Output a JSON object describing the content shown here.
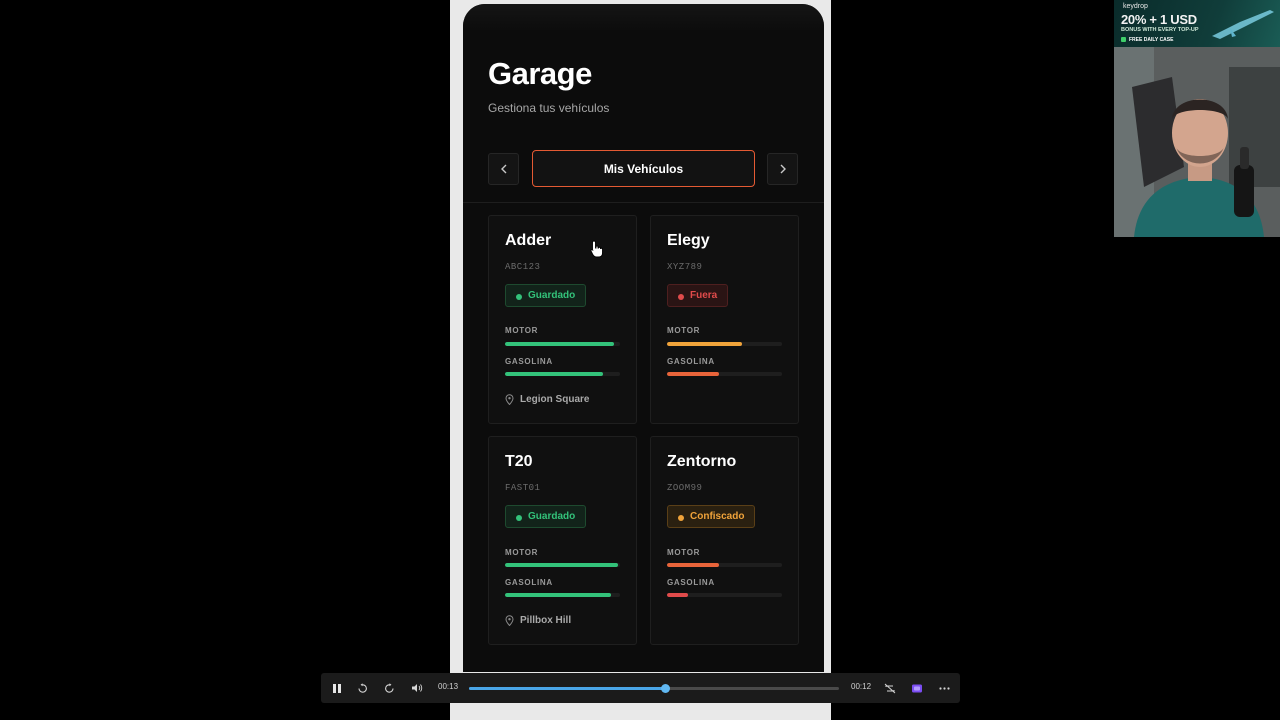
{
  "header": {
    "title": "Garage",
    "subtitle": "Gestiona tus vehículos"
  },
  "tabs": {
    "prev_icon": "chevron-left",
    "current_label": "Mis Vehículos",
    "next_icon": "chevron-right"
  },
  "vehicles": [
    {
      "name": "Adder",
      "plate": "ABC123",
      "status": "Guardado",
      "status_color": "#33c27a",
      "motor_label": "MOTOR",
      "motor": 0.95,
      "motor_color": "#33c27a",
      "fuel_label": "GASOLINA",
      "fuel": 0.85,
      "fuel_color": "#33c27a",
      "location": "Legion Square"
    },
    {
      "name": "Elegy",
      "plate": "XYZ789",
      "status": "Fuera",
      "status_color": "#e04b4b",
      "motor_label": "MOTOR",
      "motor": 0.65,
      "motor_color": "#f0a33a",
      "fuel_label": "GASOLINA",
      "fuel": 0.45,
      "fuel_color": "#e8643a",
      "location": ""
    },
    {
      "name": "T20",
      "plate": "FAST01",
      "status": "Guardado",
      "status_color": "#33c27a",
      "motor_label": "MOTOR",
      "motor": 0.98,
      "motor_color": "#33c27a",
      "fuel_label": "GASOLINA",
      "fuel": 0.92,
      "fuel_color": "#33c27a",
      "location": "Pillbox Hill"
    },
    {
      "name": "Zentorno",
      "plate": "ZOOM99",
      "status": "Confiscado",
      "status_color": "#f0a33a",
      "motor_label": "MOTOR",
      "motor": 0.45,
      "motor_color": "#e8643a",
      "fuel_label": "GASOLINA",
      "fuel": 0.18,
      "fuel_color": "#e04b4b",
      "location": ""
    }
  ],
  "player": {
    "elapsed": "00:13",
    "remaining": "00:12",
    "progress": 0.53
  },
  "ad": {
    "brand": "keydrop",
    "headline": "20% + 1 USD",
    "subline": "BONUS WITH EVERY TOP-UP",
    "badge": "FREE DAILY CASE"
  }
}
